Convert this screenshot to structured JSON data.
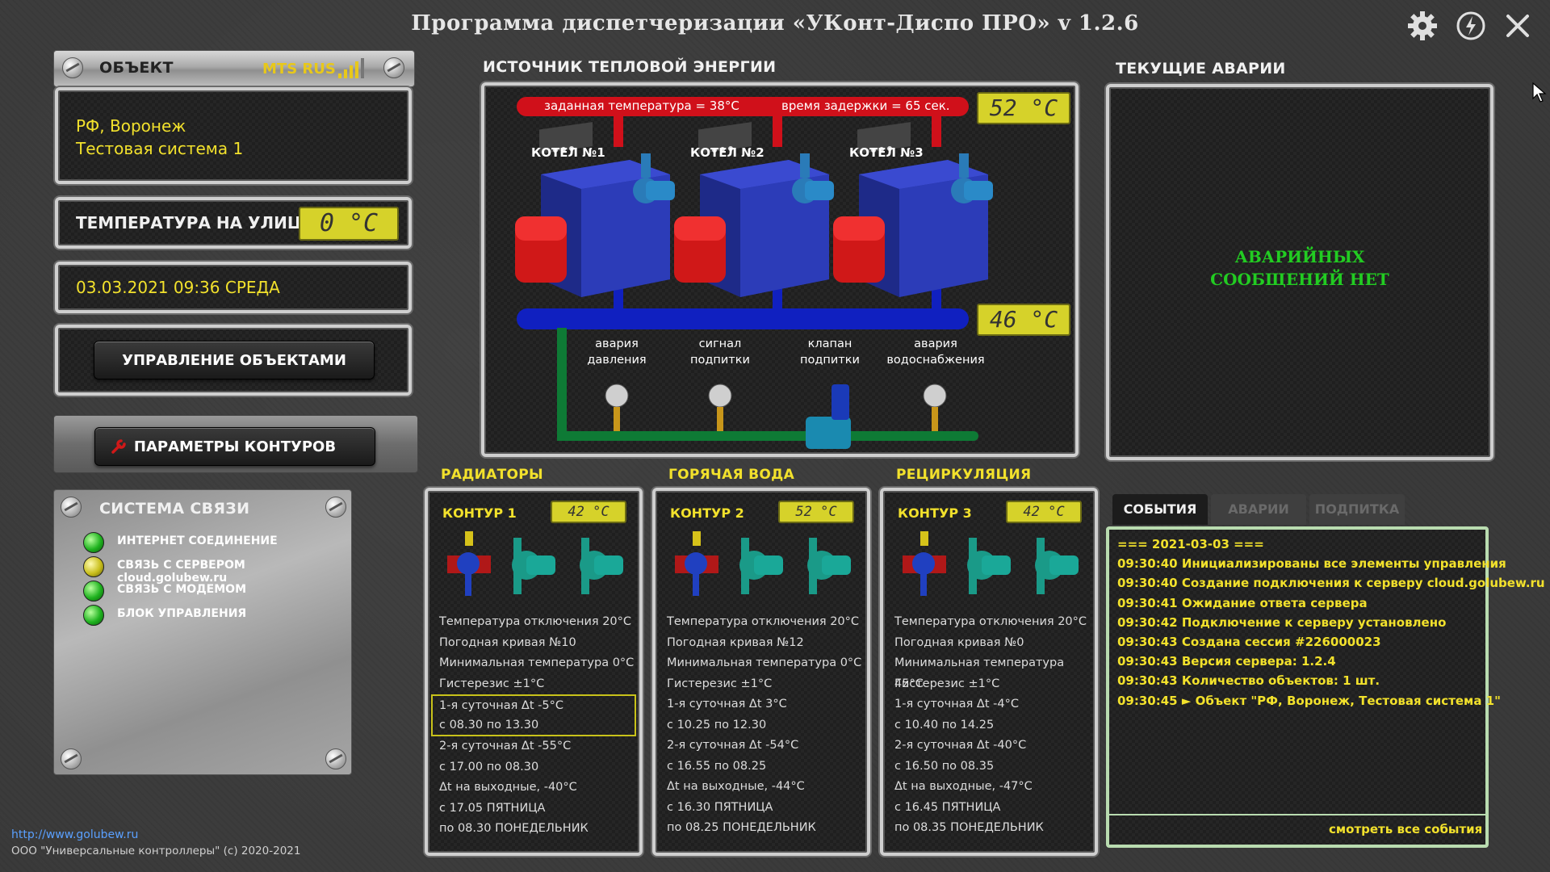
{
  "window": {
    "title": "Программа диспетчеризации «УКонт-Диспо ПРО» v 1.2.6"
  },
  "object_panel": {
    "header": "ОБЪЕКТ",
    "operator": "MTS RUS",
    "line1": "РФ, Воронеж",
    "line2": "Тестовая система 1"
  },
  "outdoor": {
    "label": "ТЕМПЕРАТУРА НА УЛИЦЕ",
    "value": "0 °C"
  },
  "datetime": {
    "text": "03.03.2021  09:36  СРЕДА"
  },
  "buttons": {
    "manage_objects": "УПРАВЛЕНИЕ ОБЪЕКТАМИ",
    "contour_params": "ПАРАМЕТРЫ КОНТУРОВ",
    "view_all_events": "смотреть все события"
  },
  "comm": {
    "header": "СИСТЕМА СВЯЗИ",
    "items": [
      {
        "label": "ИНТЕРНЕТ СОЕДИНЕНИЕ",
        "status": "green"
      },
      {
        "label": "СВЯЗЬ С СЕРВЕРОМ cloud.golubew.ru",
        "status": "yellow"
      },
      {
        "label": "СВЯЗЬ С МОДЕМОМ",
        "status": "green"
      },
      {
        "label": "БЛОК УПРАВЛЕНИЯ",
        "status": "green"
      }
    ]
  },
  "footer": {
    "link": "http://www.golubew.ru",
    "copyright": "ООО \"Универсальные контроллеры\" (c) 2020-2021"
  },
  "source": {
    "header": "ИСТОЧНИК ТЕПЛОВОЙ ЭНЕРГИИ",
    "setpoint_text": "заданная температура = 38°C",
    "delay_text": "время задержки = 65 сек.",
    "supply_temp": "52 °C",
    "return_temp": "46 °C",
    "boilers": [
      "КОТЕЛ №1",
      "КОТЕЛ №2",
      "КОТЕЛ №3"
    ],
    "sensors": [
      {
        "line1": "авария",
        "line2": "давления"
      },
      {
        "line1": "сигнал",
        "line2": "подпитки"
      },
      {
        "line1": "клапан",
        "line2": "подпитки"
      },
      {
        "line1": "авария",
        "line2": "водоснабжения"
      }
    ]
  },
  "alarms": {
    "header": "ТЕКУЩИЕ АВАРИИ",
    "message_line1": "АВАРИЙНЫХ",
    "message_line2": "СООБЩЕНИЙ НЕТ"
  },
  "contours": [
    {
      "section": "РАДИАТОРЫ",
      "name": "КОНТУР 1",
      "temp": "42 °C",
      "lines": [
        "Температура отключения 20°C",
        "Погодная кривая №10",
        "Минимальная температура 0°C",
        "Гистерезис ±1°C",
        "1-я суточная Δt -5°C",
        "с 08.30 по 13.30",
        "2-я суточная Δt -55°C",
        "с 17.00 по 08.30",
        "Δt на выходные, -40°C",
        "с 17.05 ПЯТНИЦА",
        "по 08.30 ПОНЕДЕЛЬНИК"
      ]
    },
    {
      "section": "ГОРЯЧАЯ ВОДА",
      "name": "КОНТУР 2",
      "temp": "52 °C",
      "lines": [
        "Температура отключения 20°C",
        "Погодная кривая №12",
        "Минимальная температура 0°C",
        "Гистерезис ±1°C",
        "1-я суточная Δt 3°C",
        "с 10.25 по 12.30",
        "2-я суточная Δt -54°C",
        "с 16.55 по 08.25",
        "Δt на выходные, -44°C",
        "с 16.30 ПЯТНИЦА",
        "по 08.25 ПОНЕДЕЛЬНИК"
      ]
    },
    {
      "section": "РЕЦИРКУЛЯЦИЯ",
      "name": "КОНТУР 3",
      "temp": "42 °C",
      "lines": [
        "Температура отключения 20°C",
        "Погодная кривая №0",
        "Минимальная температура 45°C",
        "Гистерезис ±1°C",
        "1-я суточная Δt -4°C",
        "с 10.40 по 14.25",
        "2-я суточная Δt -40°C",
        "с 16.50 по 08.35",
        "Δt на выходные, -47°C",
        "с 16.45 ПЯТНИЦА",
        "по 08.35 ПОНЕДЕЛЬНИК"
      ]
    }
  ],
  "events": {
    "tabs": [
      "СОБЫТИЯ",
      "АВАРИИ",
      "ПОДПИТКА"
    ],
    "active_tab": "СОБЫТИЯ",
    "lines": [
      "=== 2021-03-03 ===",
      "09:30:40 Инициализированы все элементы управления",
      "09:30:40 Создание подключения к серверу cloud.golubew.ru",
      "09:30:41 Ожидание ответа сервера",
      "09:30:42 Подключение к серверу установлено",
      "09:30:43 Создана сессия #226000023",
      "09:30:43 Версия сервера: 1.2.4",
      "09:30:43 Количество объектов: 1 шт.",
      "09:30:45 ► Объект \"РФ, Воронеж, Тестовая система 1\""
    ]
  },
  "colors": {
    "supply_pipe": "#d0101a",
    "return_pipe": "#1020c0",
    "feed_pipe": "#0e7a35",
    "display_yellow": "#d6d22a",
    "text_yellow": "#f2e12c",
    "alarm_ok_green": "#22cc22"
  }
}
